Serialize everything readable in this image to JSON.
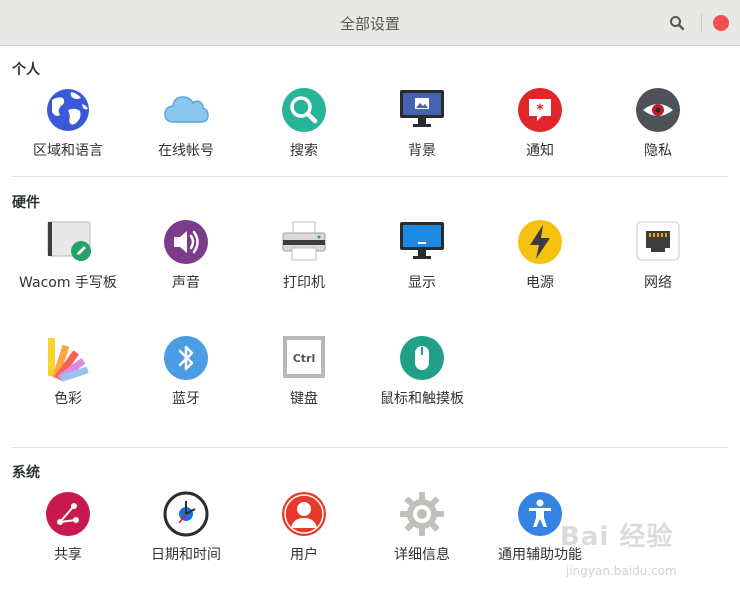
{
  "window": {
    "title": "全部设置"
  },
  "sections": {
    "personal": {
      "title": "个人",
      "items": [
        "区域和语言",
        "在线帐号",
        "搜索",
        "背景",
        "通知",
        "隐私"
      ]
    },
    "hardware": {
      "title": "硬件",
      "items": [
        "Wacom 手写板",
        "声音",
        "打印机",
        "显示",
        "电源",
        "网络",
        "色彩",
        "蓝牙",
        "键盘",
        "鼠标和触摸板"
      ]
    },
    "system": {
      "title": "系统",
      "items": [
        "共享",
        "日期和时间",
        "用户",
        "详细信息",
        "通用辅助功能"
      ]
    }
  },
  "keyboard_icon_text": "Ctrl",
  "watermark": {
    "main": "Bai 经验",
    "sub": "jingyan.baidu.com"
  },
  "colors": {
    "close": "#ef4f4f",
    "sharing": "#c7184f",
    "search": "#26b49a",
    "notifications": "#e0262b",
    "sound": "#7d3b8b",
    "bluetooth": "#4a9de3",
    "power": "#f5c211",
    "mouse": "#20a087",
    "accessibility": "#3584e4",
    "user": "#e53a2c"
  }
}
